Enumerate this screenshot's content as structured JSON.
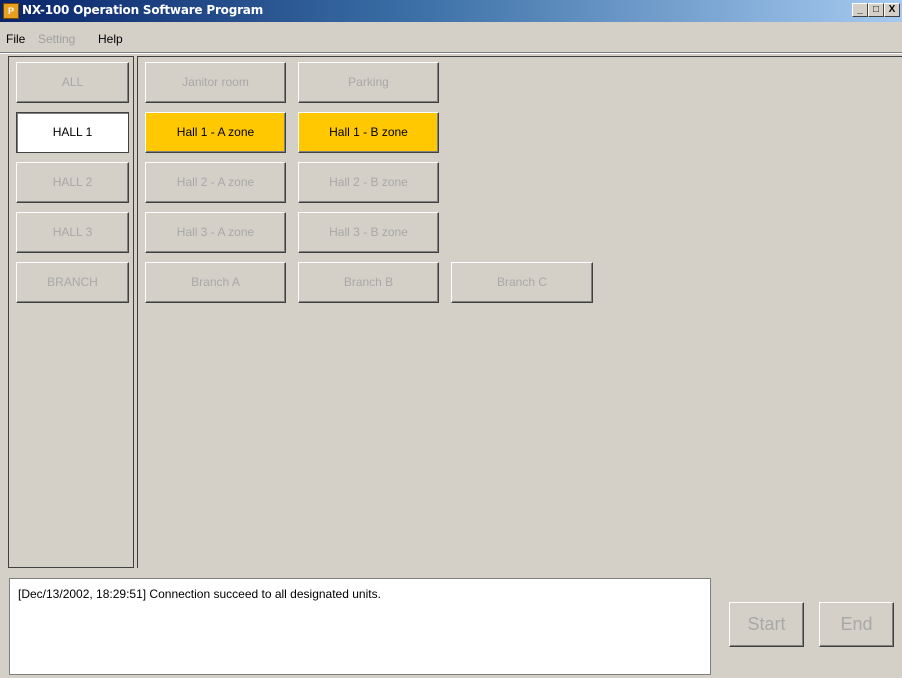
{
  "window": {
    "title": "NX-100 Operation Software Program",
    "icon_label": "P",
    "controls": {
      "minimize": "_",
      "maximize": "□",
      "close": "X"
    }
  },
  "menu": {
    "file": "File",
    "setting": "Setting",
    "help": "Help"
  },
  "groups": [
    {
      "label": "ALL",
      "state": "disabled"
    },
    {
      "label": "HALL 1",
      "state": "selected"
    },
    {
      "label": "HALL 2",
      "state": "disabled"
    },
    {
      "label": "HALL 3",
      "state": "disabled"
    },
    {
      "label": "BRANCH",
      "state": "disabled"
    }
  ],
  "zones": [
    [
      {
        "label": "Janitor room",
        "state": "disabled"
      },
      {
        "label": "Parking",
        "state": "disabled"
      }
    ],
    [
      {
        "label": "Hall 1 - A zone",
        "state": "active"
      },
      {
        "label": "Hall 1 - B zone",
        "state": "active"
      }
    ],
    [
      {
        "label": "Hall 2 - A zone",
        "state": "disabled"
      },
      {
        "label": "Hall 2 - B zone",
        "state": "disabled"
      }
    ],
    [
      {
        "label": "Hall 3 - A zone",
        "state": "disabled"
      },
      {
        "label": "Hall 3 - B zone",
        "state": "disabled"
      }
    ],
    [
      {
        "label": "Branch A",
        "state": "disabled"
      },
      {
        "label": "Branch B",
        "state": "disabled"
      },
      {
        "label": "Branch C",
        "state": "disabled"
      }
    ]
  ],
  "log": {
    "message": "[Dec/13/2002, 18:29:51] Connection succeed to all designated units."
  },
  "actions": {
    "start": "Start",
    "end": "End"
  },
  "colors": {
    "active_zone": "#ffc800",
    "selected_group": "#ffffff",
    "window_bg": "#d4d0c8"
  }
}
